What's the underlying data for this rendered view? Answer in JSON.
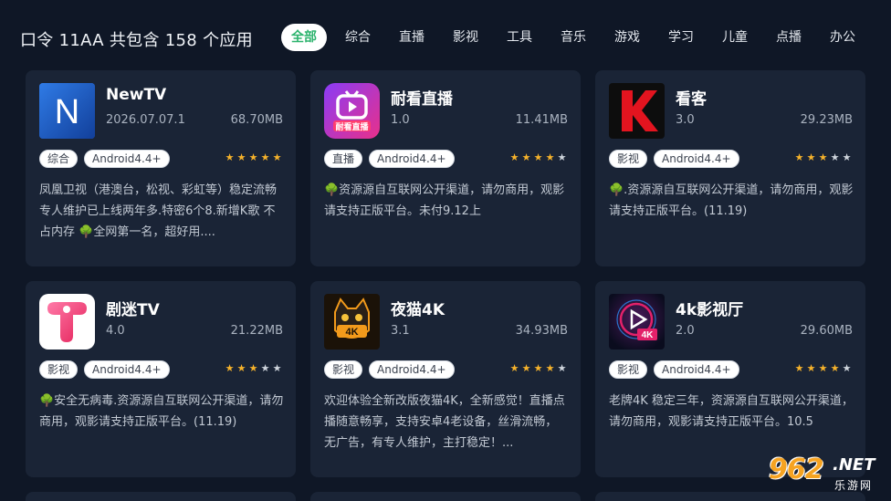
{
  "header": {
    "title": "口令 11AA 共包含 158 个应用"
  },
  "tabs": [
    {
      "label": "全部",
      "active": true
    },
    {
      "label": "综合"
    },
    {
      "label": "直播"
    },
    {
      "label": "影视"
    },
    {
      "label": "工具"
    },
    {
      "label": "音乐"
    },
    {
      "label": "游戏"
    },
    {
      "label": "学习"
    },
    {
      "label": "儿童"
    },
    {
      "label": "点播"
    },
    {
      "label": "办公"
    }
  ],
  "apps": [
    {
      "name": "NewTV",
      "version": "2026.07.07.1",
      "size": "68.70MB",
      "category": "综合",
      "requirement": "Android4.4+",
      "rating": 5,
      "icon": "newtv-logo-icon",
      "description": "凤凰卫视（港澳台，松视、彩虹等）稳定流畅 专人维护已上线两年多.特密6个8.新增K歌 不占内存 🌳全网第一名，超好用...."
    },
    {
      "name": "耐看直播",
      "version": "1.0",
      "size": "11.41MB",
      "category": "直播",
      "requirement": "Android4.4+",
      "rating": 4,
      "icon": "tv-play-logo-icon",
      "description": "🌳资源源自互联网公开渠道，请勿商用，观影请支持正版平台。未付9.12上"
    },
    {
      "name": "看客",
      "version": "3.0",
      "size": "29.23MB",
      "category": "影视",
      "requirement": "Android4.4+",
      "rating": 3,
      "icon": "k-logo-icon",
      "description": "🌳.资源源自互联网公开渠道，请勿商用，观影请支持正版平台。(11.19)"
    },
    {
      "name": "剧迷TV",
      "version": "4.0",
      "size": "21.22MB",
      "category": "影视",
      "requirement": "Android4.4+",
      "rating": 3,
      "icon": "t-logo-icon",
      "description": "🌳安全无病毒.资源源自互联网公开渠道，请勿商用，观影请支持正版平台。(11.19)"
    },
    {
      "name": "夜猫4K",
      "version": "3.1",
      "size": "34.93MB",
      "category": "影视",
      "requirement": "Android4.4+",
      "rating": 4,
      "icon": "cat-4k-logo-icon",
      "description": "欢迎体验全新改版夜猫4K，全新感觉！直播点播随意畅享，支持安卓4老设备，丝滑流畅，无广告，有专人维护，主打稳定！..."
    },
    {
      "name": "4k影视厅",
      "version": "2.0",
      "size": "29.60MB",
      "category": "影视",
      "requirement": "Android4.4+",
      "rating": 4,
      "icon": "play-4k-logo-icon",
      "description": "老牌4K 稳定三年，资源源自互联网公开渠道，请勿商用，观影请支持正版平台。10.5"
    }
  ],
  "watermark": {
    "number": "962",
    "suffix": ".NET",
    "site": "乐游网"
  },
  "colors": {
    "background": "#0f1726",
    "card": "#1a2436",
    "active_tab": "#2cb36d",
    "star": "#f7b32b"
  }
}
